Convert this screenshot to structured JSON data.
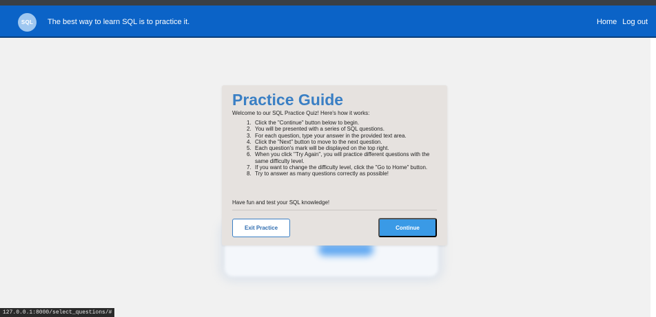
{
  "header": {
    "logo_text": "SQL",
    "tagline": "The best way to learn SQL is to practice it.",
    "nav": [
      "Home",
      "Log out"
    ]
  },
  "guide": {
    "title": "Practice Guide",
    "intro": "Welcome to our SQL Practice Quiz! Here's how it works:",
    "steps": [
      "Click the \"Continue\" button below to begin.",
      "You will be presented with a series of SQL questions.",
      "For each question, type your answer in the provided text area.",
      "Click the \"Next\" button to move to the next question.",
      "Each question's mark will be displayed on the top right.",
      "When you click \"Try Again\", you will practice different questions with the same difficulty level.",
      "If you want to change the difficulty level, click the \"Go to Home\" button.",
      "Try to answer as many questions correctly as possible!"
    ],
    "outro": "Have fun and test your SQL knowledge!",
    "exit_label": "Exit Practice",
    "continue_label": "Continue"
  },
  "status_bar": {
    "url": "127.0.0.1:8000/select_questions/#"
  },
  "colors": {
    "navbar": "#0b63c7",
    "accent": "#3a7fc4",
    "continue_button": "#3a9ae6",
    "modal_bg": "#e6e2df"
  }
}
